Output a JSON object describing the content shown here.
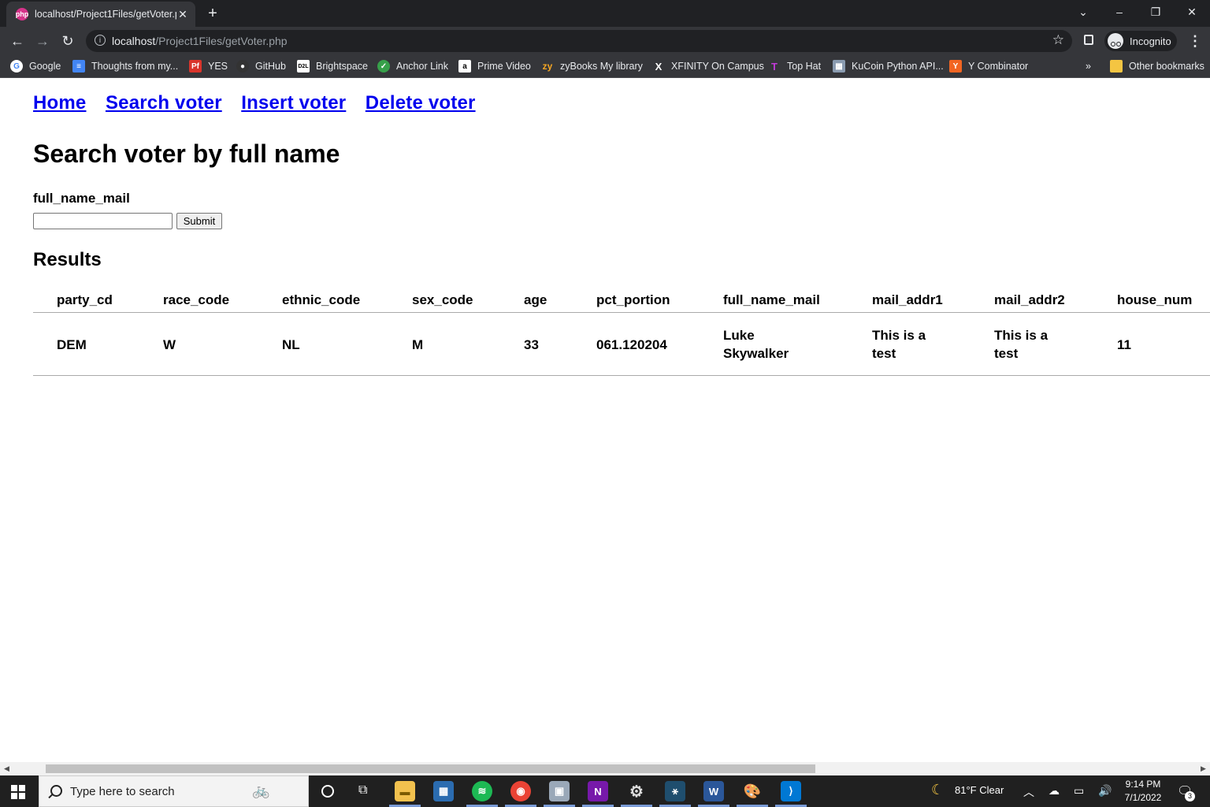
{
  "browser": {
    "tab_title": "localhost/Project1Files/getVoter.php",
    "url_host": "localhost",
    "url_path": "/Project1Files/getVoter.php",
    "profile_label": "Incognito",
    "bookmarks": [
      "Google",
      "Thoughts from my...",
      "YES",
      "GitHub",
      "Brightspace",
      "Anchor Link",
      "Prime Video",
      "zyBooks My library",
      "XFINITY On Campus",
      "Top Hat",
      "KuCoin Python API...",
      "Y Combinator"
    ],
    "other_bookmarks": "Other bookmarks",
    "more_bookmarks": "»"
  },
  "page": {
    "nav": [
      "Home",
      "Search voter",
      "Insert voter",
      "Delete voter"
    ],
    "title": "Search voter by full name",
    "field_label": "full_name_mail",
    "input_value": "",
    "submit_label": "Submit",
    "results_heading": "Results",
    "table": {
      "columns": [
        "party_cd",
        "race_code",
        "ethnic_code",
        "sex_code",
        "age",
        "pct_portion",
        "full_name_mail",
        "mail_addr1",
        "mail_addr2",
        "house_num"
      ],
      "rows": [
        [
          "DEM",
          "W",
          "NL",
          "M",
          "33",
          "061.120204",
          "Luke Skywalker",
          "This is a test",
          "This is a test",
          "11"
        ]
      ]
    }
  },
  "taskbar": {
    "search_placeholder": "Type here to search",
    "weather": "81°F  Clear",
    "time": "9:14 PM",
    "date": "7/1/2022",
    "notification_count": "3"
  }
}
